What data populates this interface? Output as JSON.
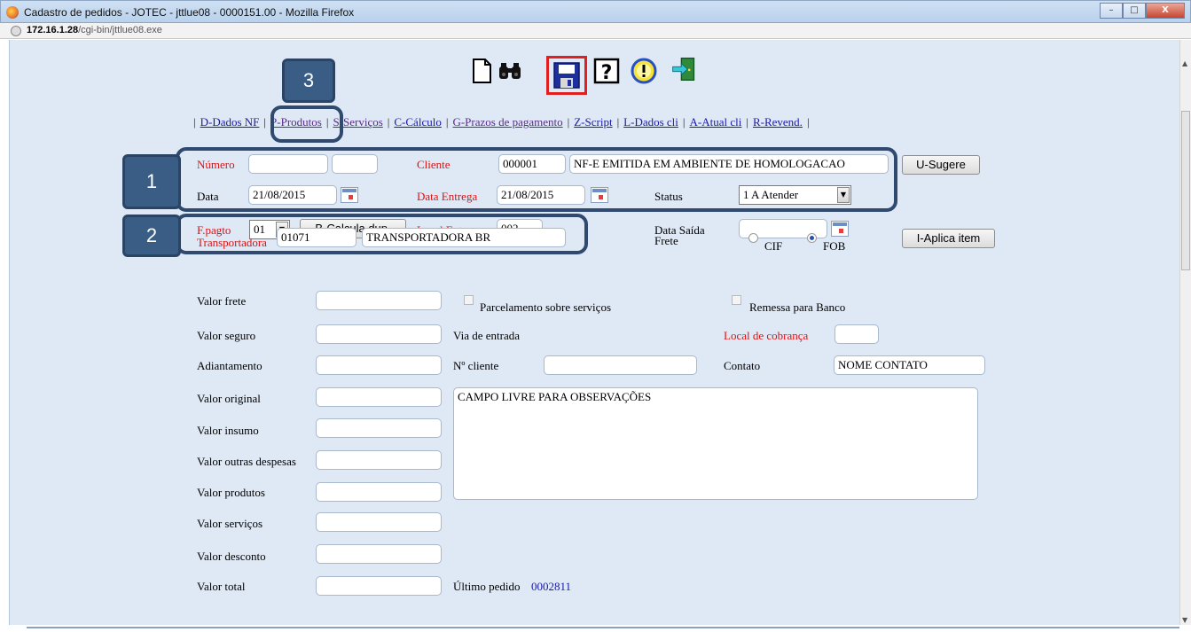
{
  "window": {
    "title": "Cadastro de pedidos - JOTEC - jttlue08 - 0000151.00 - Mozilla Firefox",
    "url_host": "172.16.1.28",
    "url_path": "/cgi-bin/jttlue08.exe",
    "btn_min": "–",
    "btn_max": "□",
    "btn_close": "X"
  },
  "toolbar": {
    "icons": [
      "new-document-icon",
      "search-binoculars-icon",
      "save-icon",
      "help-icon",
      "alert-icon",
      "exit-icon"
    ]
  },
  "tabs": {
    "dados_nf": "D-Dados NF",
    "produtos": "P-Produtos",
    "servicos": "S-Serviços",
    "calculo": "C-Cálculo",
    "prazos": "G-Prazos de pagamento",
    "script": "Z-Script",
    "dados_cli": "L-Dados cli",
    "atual_cli": "A-Atual cli",
    "revend": "R-Revend."
  },
  "form": {
    "numero_label": "Número",
    "numero_value": "",
    "numero_value2": "",
    "cliente_label": "Cliente",
    "cliente_code": "000001",
    "cliente_name": "NF-E EMITIDA EM AMBIENTE DE HOMOLOGACAO",
    "sugere_button": "U-Sugere",
    "data_label": "Data",
    "data_value": "21/08/2015",
    "data_entrega_label": "Data Entrega",
    "data_entrega_value": "21/08/2015",
    "status_label": "Status",
    "status_value": "1 A Atender",
    "fpagto_label": "F.pagto",
    "fpagto_value": "01",
    "calcula_button": "B-Calcula dup.",
    "local_entrega_label": "Local Entrega",
    "local_entrega_value": "002",
    "data_saida_label": "Data Saída",
    "data_saida_value": "",
    "transportadora_label": "Transportadora",
    "transportadora_code": "01071",
    "transportadora_name": "TRANSPORTADORA BR",
    "frete_label": "Frete",
    "frete_cif": "CIF",
    "frete_fob": "FOB",
    "frete_selected": "FOB",
    "aplica_button": "I-Aplica item",
    "valor_frete_label": "Valor frete",
    "parcelamento_label": "Parcelamento sobre serviços",
    "remessa_label": "Remessa para Banco",
    "valor_seguro_label": "Valor seguro",
    "via_entrada_label": "Via de entrada",
    "local_cobranca_label": "Local de cobrança",
    "adiantamento_label": "Adiantamento",
    "n_cliente_label": "Nº cliente",
    "contato_label": "Contato",
    "contato_value": "NOME CONTATO",
    "valor_original_label": "Valor original",
    "observacoes_value": "CAMPO LIVRE PARA OBSERVAÇÕES",
    "valor_insumo_label": "Valor insumo",
    "valor_outras_label": "Valor outras despesas",
    "valor_produtos_label": "Valor produtos",
    "valor_servicos_label": "Valor serviços",
    "valor_desconto_label": "Valor desconto",
    "valor_total_label": "Valor total",
    "ultimo_pedido_label": "Último pedido",
    "ultimo_pedido_value": "0002811"
  },
  "callouts": {
    "c1": "1",
    "c2": "2",
    "c3": "3"
  },
  "colors": {
    "page_bg": "#dfe9f6",
    "required_label": "#e01010",
    "callout_bg": "#3a5d86",
    "highlight_save": "#e02020"
  }
}
